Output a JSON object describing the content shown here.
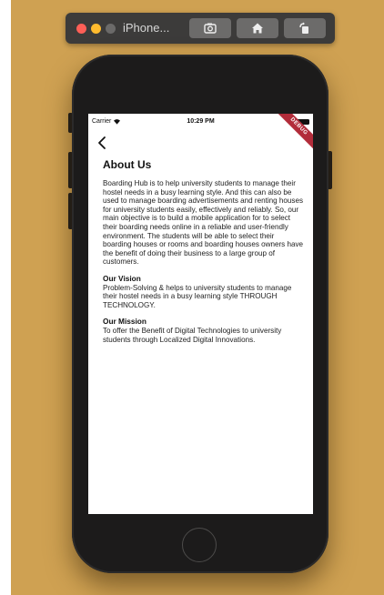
{
  "simulator": {
    "title": "iPhone...",
    "buttons": [
      "screenshot-icon",
      "home-icon",
      "rotate-icon"
    ]
  },
  "status_bar": {
    "carrier": "Carrier",
    "time": "10:29 PM"
  },
  "debug_banner": "DEBUG",
  "page": {
    "title": "About Us",
    "intro": "Boarding Hub is to help university students to manage their hostel needs in a busy learning style. And this can also be used to manage boarding advertisements and renting houses for university students easily, effectively and reliably. So, our main objective is to build a mobile application for to select their boarding needs online in a reliable and user-friendly environment. The students will be able to select their boarding houses or rooms and boarding houses owners have the benefit of doing their business to a large group of customers.",
    "vision_heading": "Our Vision",
    "vision_text": "Problem-Solving & helps to university students to manage their hostel needs in a busy learning style THROUGH TECHNOLOGY.",
    "mission_heading": "Our Mission",
    "mission_text": "To offer the Benefit of Digital Technologies to university students through Localized Digital Innovations."
  },
  "colors": {
    "background": "#cfa152",
    "phone": "#1c1b1b",
    "debug": "#b22c3a"
  }
}
